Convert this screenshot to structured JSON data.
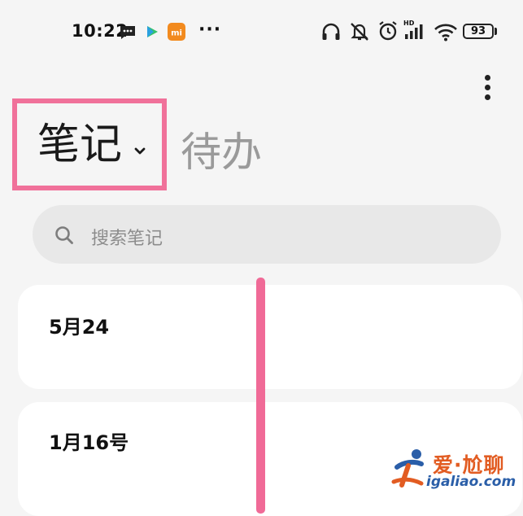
{
  "status_bar": {
    "time": "10:22",
    "more_notifications": "···",
    "signal_hd": "HD",
    "battery": "93"
  },
  "header": {
    "more_menu_icon": "more-vertical-icon"
  },
  "tabs": {
    "notes_label": "笔记",
    "todo_label": "待办"
  },
  "search": {
    "placeholder": "搜索笔记"
  },
  "notes": [
    {
      "title": "5月24"
    },
    {
      "title": "1月16号"
    }
  ],
  "watermark": {
    "title": "爱·尬聊",
    "url": "igaliao.com"
  },
  "colors": {
    "highlight": "#f0719a",
    "annotation_line": "#f06a97",
    "background": "#f5f5f5",
    "search_bg": "#e8e8e8"
  }
}
